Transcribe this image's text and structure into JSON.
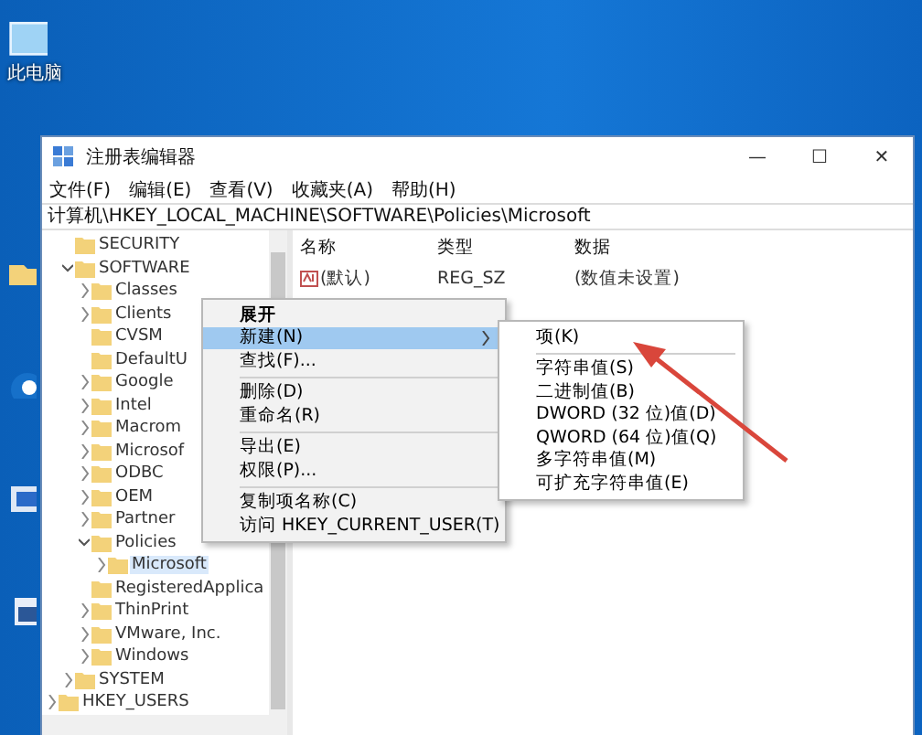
{
  "desktop": {
    "icons": [
      {
        "kind": "computer",
        "label": "此电脑"
      },
      {
        "kind": "folder"
      },
      {
        "kind": "edge"
      },
      {
        "kind": "app"
      },
      {
        "kind": "doc"
      }
    ]
  },
  "window": {
    "title": "注册表编辑器",
    "controls": [
      "—",
      "☐",
      "✕"
    ]
  },
  "menu": [
    "文件(F)",
    "编辑(E)",
    "查看(V)",
    "收藏夹(A)",
    "帮助(H)"
  ],
  "address": "计算机\\HKEY_LOCAL_MACHINE\\SOFTWARE\\Policies\\Microsoft",
  "tree": {
    "items": [
      {
        "children": [
          {
            "label": "SECURITY",
            "expanded": false,
            "has_children": false,
            "selected": false
          },
          {
            "label": "SOFTWARE",
            "expanded": true,
            "has_children": true,
            "selected": false,
            "children": [
              {
                "label": "Classes",
                "expanded": false,
                "has_children": true,
                "selected": false
              },
              {
                "label": "Clients",
                "expanded": false,
                "has_children": true,
                "selected": false
              },
              {
                "label": "CVSM",
                "expanded": false,
                "has_children": false,
                "selected": false
              },
              {
                "label": "DefaultU",
                "expanded": false,
                "has_children": false,
                "selected": false
              },
              {
                "label": "Google",
                "expanded": false,
                "has_children": true,
                "selected": false
              },
              {
                "label": "Intel",
                "expanded": false,
                "has_children": true,
                "selected": false
              },
              {
                "label": "Macrom",
                "expanded": false,
                "has_children": true,
                "selected": false
              },
              {
                "label": "Microsof",
                "expanded": false,
                "has_children": true,
                "selected": false
              },
              {
                "label": "ODBC",
                "expanded": false,
                "has_children": true,
                "selected": false
              },
              {
                "label": "OEM",
                "expanded": false,
                "has_children": true,
                "selected": false
              },
              {
                "label": "Partner",
                "expanded": false,
                "has_children": true,
                "selected": false
              },
              {
                "label": "Policies",
                "expanded": true,
                "has_children": true,
                "selected": false,
                "children": [
                  {
                    "label": "Microsoft",
                    "expanded": false,
                    "has_children": true,
                    "selected": true
                  }
                ]
              },
              {
                "label": "RegisteredApplica",
                "expanded": false,
                "has_children": false,
                "selected": false
              },
              {
                "label": "ThinPrint",
                "expanded": false,
                "has_children": true,
                "selected": false
              },
              {
                "label": "VMware, Inc.",
                "expanded": false,
                "has_children": true,
                "selected": false
              },
              {
                "label": "Windows",
                "expanded": false,
                "has_children": true,
                "selected": false
              }
            ]
          },
          {
            "label": "SYSTEM",
            "expanded": false,
            "has_children": true,
            "selected": false
          }
        ]
      },
      {
        "label": "HKEY_USERS",
        "expanded": false,
        "has_children": true,
        "selected": false
      }
    ]
  },
  "table": {
    "columns": [
      "名称",
      "类型",
      "数据"
    ],
    "rows": [
      [
        "(默认)",
        "REG_SZ",
        "(数值未设置)"
      ]
    ]
  },
  "context_menu": {
    "items": [
      {
        "kind": "item",
        "label": "展开",
        "selected": false,
        "bold": true
      },
      {
        "kind": "item",
        "label": "新建(N)",
        "selected": true,
        "submenu": true
      },
      {
        "kind": "item",
        "label": "查找(F)..."
      },
      {
        "kind": "separator"
      },
      {
        "kind": "item",
        "label": "删除(D)"
      },
      {
        "kind": "item",
        "label": "重命名(R)"
      },
      {
        "kind": "separator"
      },
      {
        "kind": "item",
        "label": "导出(E)"
      },
      {
        "kind": "item",
        "label": "权限(P)..."
      },
      {
        "kind": "separator"
      },
      {
        "kind": "item",
        "label": "复制项名称(C)"
      },
      {
        "kind": "item",
        "label": "访问 HKEY_CURRENT_USER(T)"
      }
    ]
  },
  "submenu": {
    "items": [
      {
        "kind": "item",
        "label": "项(K)"
      },
      {
        "kind": "separator"
      },
      {
        "kind": "item",
        "label": "字符串值(S)"
      },
      {
        "kind": "item",
        "label": "二进制值(B)"
      },
      {
        "kind": "item",
        "label": "DWORD (32 位)值(D)"
      },
      {
        "kind": "item",
        "label": "QWORD (64 位)值(Q)"
      },
      {
        "kind": "item",
        "label": "多字符串值(M)"
      },
      {
        "kind": "item",
        "label": "可扩充字符串值(E)"
      }
    ]
  },
  "annotation": {
    "kind": "arrow"
  }
}
